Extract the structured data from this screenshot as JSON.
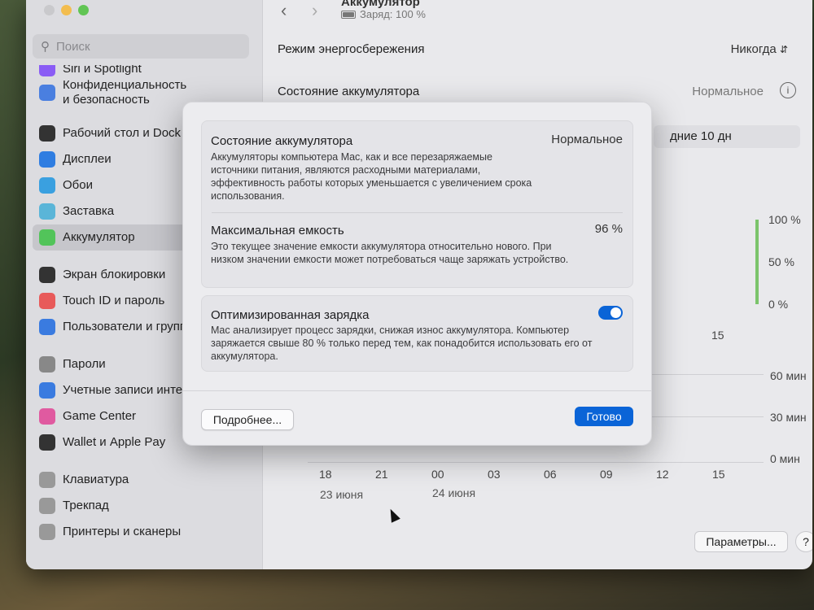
{
  "window": {
    "title": "Аккумулятор",
    "subtitle": "Заряд: 100 %"
  },
  "sidebar": {
    "search_placeholder": "Поиск",
    "items": [
      {
        "label": "Siri и Spotlight",
        "icon": "siri-icon",
        "color": "#8a5cf5"
      },
      {
        "label": "Конфиденциальность\nи безопасность",
        "icon": "hand-icon",
        "color": "#4a7fe0"
      },
      {
        "label": "Рабочий стол и Dock",
        "icon": "dock-icon",
        "color": "#333333"
      },
      {
        "label": "Дисплеи",
        "icon": "sun-icon",
        "color": "#2f7de1"
      },
      {
        "label": "Обои",
        "icon": "flower-icon",
        "color": "#3aa0e0"
      },
      {
        "label": "Заставка",
        "icon": "screensaver-icon",
        "color": "#5ab5d8"
      },
      {
        "label": "Аккумулятор",
        "icon": "battery-icon",
        "color": "#52c45a"
      },
      {
        "label": "Экран блокировки",
        "icon": "lock-icon",
        "color": "#333333"
      },
      {
        "label": "Touch ID и пароль",
        "icon": "fingerprint-icon",
        "color": "#e85a5a"
      },
      {
        "label": "Пользователи и группы",
        "icon": "users-icon",
        "color": "#3a7be0"
      },
      {
        "label": "Пароли",
        "icon": "key-icon",
        "color": "#888888"
      },
      {
        "label": "Учетные записи интернета",
        "icon": "at-icon",
        "color": "#3a7be0"
      },
      {
        "label": "Game Center",
        "icon": "gamecenter-icon",
        "color": "#e05aa0"
      },
      {
        "label": "Wallet и Apple Pay",
        "icon": "wallet-icon",
        "color": "#333333"
      },
      {
        "label": "Клавиатура",
        "icon": "keyboard-icon",
        "color": "#999999"
      },
      {
        "label": "Трекпад",
        "icon": "trackpad-icon",
        "color": "#999999"
      },
      {
        "label": "Принтеры и сканеры",
        "icon": "printer-icon",
        "color": "#999999"
      }
    ]
  },
  "main": {
    "power_mode_label": "Режим энергосбережения",
    "power_mode_value": "Никогда",
    "battery_health_label": "Состояние аккумулятора",
    "battery_health_value": "Нормальное",
    "period_label": "дние 10 дн",
    "chart_top_labels": [
      "100 %",
      "50 %",
      "0 %"
    ],
    "chart_top_x_label": "15",
    "chart_bottom_labels": [
      "60 мин",
      "30 мин",
      "0 мин"
    ],
    "x_ticks": [
      "18",
      "21",
      "00",
      "03",
      "06",
      "09",
      "12",
      "15"
    ],
    "date_labels": [
      "23 июня",
      "24 июня"
    ],
    "params_button": "Параметры...",
    "help_button": "?"
  },
  "modal": {
    "health_title": "Состояние аккумулятора",
    "health_value": "Нормальное",
    "health_desc": "Аккумуляторы компьютера Mac, как и все перезаряжаемые источники питания, являются расходными материалами, эффективность работы которых уменьшается с увеличением срока использования.",
    "capacity_title": "Максимальная емкость",
    "capacity_value": "96 %",
    "capacity_desc": "Это текущее значение емкости аккумулятора относительно нового. При низком значении емкости может потребоваться чаще заряжать устройство.",
    "optimized_title": "Оптимизированная зарядка",
    "optimized_on": true,
    "optimized_desc": "Mac анализирует процесс зарядки, снижая износ аккумулятора. Компьютер заряжается свыше 80 % только перед тем, как понадобится использовать его от аккумулятора.",
    "more_button": "Подробнее...",
    "done_button": "Готово"
  },
  "colors": {
    "accent": "#0a64d7",
    "chart_green": "#7bc46b"
  }
}
